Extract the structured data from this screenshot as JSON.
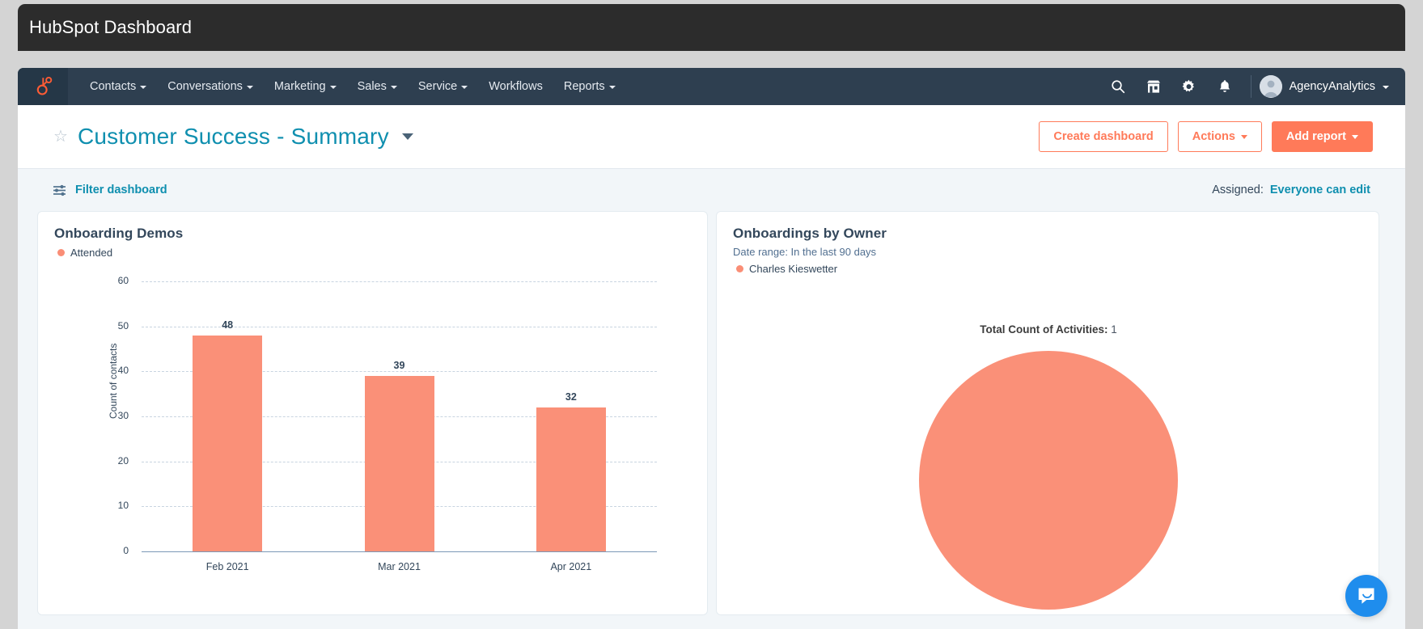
{
  "window": {
    "title": "HubSpot Dashboard"
  },
  "nav": {
    "logo": "hubspot-sprocket-logo",
    "items": [
      {
        "label": "Contacts",
        "has_caret": true
      },
      {
        "label": "Conversations",
        "has_caret": true
      },
      {
        "label": "Marketing",
        "has_caret": true
      },
      {
        "label": "Sales",
        "has_caret": true
      },
      {
        "label": "Service",
        "has_caret": true
      },
      {
        "label": "Workflows",
        "has_caret": false
      },
      {
        "label": "Reports",
        "has_caret": true
      }
    ],
    "icons": [
      "search-icon",
      "marketplace-icon",
      "settings-gear-icon",
      "notifications-bell-icon"
    ],
    "account": {
      "name": "AgencyAnalytics",
      "avatar": "user-avatar"
    }
  },
  "header": {
    "star_icon": "favorite-star-icon",
    "title": "Customer Success - Summary",
    "buttons": {
      "create_dashboard": "Create dashboard",
      "actions": "Actions",
      "add_report": "Add report"
    }
  },
  "toolbar": {
    "filter_icon": "filter-sliders-icon",
    "filter_label": "Filter dashboard",
    "assigned_label": "Assigned:",
    "assigned_value": "Everyone can edit"
  },
  "colors": {
    "brand_orange": "#ff7a59",
    "chart_coral": "#fa9078",
    "teal_link": "#0f8faf",
    "nav_dark": "#2e3f50",
    "board_bg": "#f2f6f9",
    "chat_blue": "#1f8ded"
  },
  "cards": [
    {
      "title": "Onboarding Demos",
      "legend": "Attended"
    },
    {
      "title": "Onboardings by Owner",
      "subtitle": "Date range: In the last 90 days",
      "legend": "Charles Kieswetter",
      "total_label": "Total Count of Activities:",
      "total_value": "1"
    }
  ],
  "chart_data": [
    {
      "type": "bar",
      "title": "Onboarding Demos",
      "categories": [
        "Feb 2021",
        "Mar 2021",
        "Apr 2021"
      ],
      "series": [
        {
          "name": "Attended",
          "values": [
            48,
            39,
            32
          ],
          "color": "#fa9078"
        }
      ],
      "xlabel": "",
      "ylabel": "Count of contacts",
      "ylim": [
        0,
        60
      ],
      "yticks": [
        0,
        10,
        20,
        30,
        40,
        50,
        60
      ],
      "grid": true,
      "legend_position": "top-left",
      "data_labels": [
        "48",
        "39",
        "32"
      ]
    },
    {
      "type": "pie",
      "title": "Onboardings by Owner",
      "subtitle": "Date range: In the last 90 days",
      "annotation": "Total Count of Activities: 1",
      "labels": [
        "Charles Kieswetter"
      ],
      "values": [
        1
      ],
      "colors": [
        "#fa9078"
      ],
      "legend_position": "top-left"
    }
  ],
  "chat": {
    "icon": "chat-bubble-icon"
  }
}
